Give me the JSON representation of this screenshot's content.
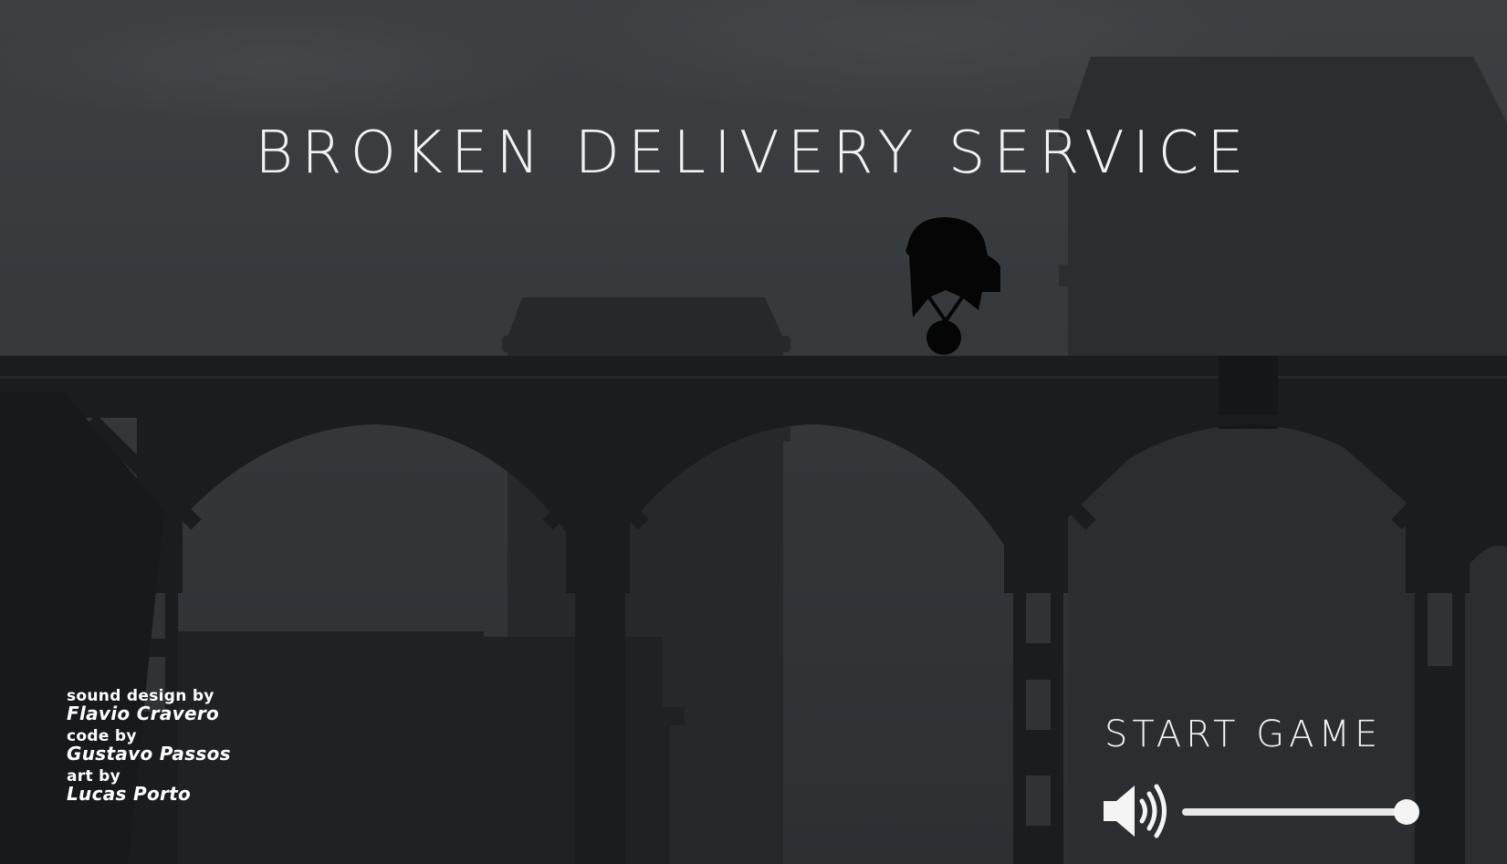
{
  "game": {
    "title": "BROKEN DELIVERY SERVICE"
  },
  "menu": {
    "start_label": "START GAME"
  },
  "credits": [
    {
      "role": "sound design by",
      "name": "Flavio Cravero"
    },
    {
      "role": "code by",
      "name": "Gustavo Passos"
    },
    {
      "role": "art by",
      "name": "Lucas Porto"
    }
  ],
  "volume": {
    "icon": "speaker-volume-icon",
    "level_fraction": 1.0
  },
  "colors": {
    "sky": "#3a3e41",
    "silhouette_dark": "#16191b",
    "silhouette_mid": "#23272a",
    "text": "#f2f2f2"
  }
}
